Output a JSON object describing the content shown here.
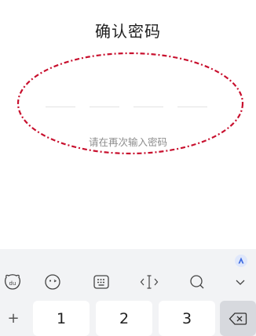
{
  "header": {
    "title": "确认密码"
  },
  "pin": {
    "slots": 4,
    "hint": "请在再次输入密码"
  },
  "keyboard": {
    "toolbar": [
      {
        "name": "emoji-face-icon"
      },
      {
        "name": "smiley-icon"
      },
      {
        "name": "keyboard-icon"
      },
      {
        "name": "cursor-icon"
      },
      {
        "name": "search-icon"
      },
      {
        "name": "chevron-down-icon"
      }
    ],
    "keys": {
      "plus": "+",
      "one": "1",
      "two": "2",
      "three": "3"
    }
  },
  "colors": {
    "annotation": "#c8102e",
    "assist_badge": "#3e6be0"
  }
}
